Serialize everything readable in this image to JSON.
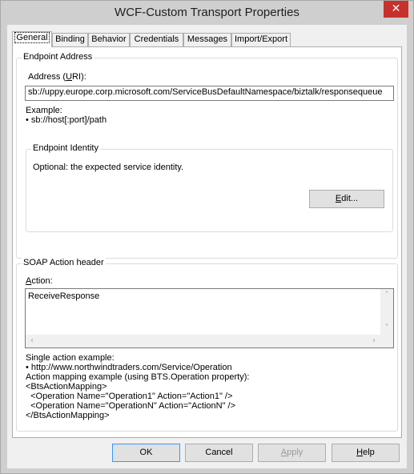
{
  "window": {
    "title": "WCF-Custom Transport Properties",
    "close_glyph": "✕"
  },
  "tabs": [
    {
      "label": "General",
      "active": true
    },
    {
      "label": "Binding"
    },
    {
      "label": "Behavior"
    },
    {
      "label": "Credentials"
    },
    {
      "label": "Messages"
    },
    {
      "label": "Import/Export"
    }
  ],
  "endpoint_address": {
    "group_label": "Endpoint Address",
    "address_label_pre": "Address (",
    "address_label_u": "U",
    "address_label_post": "RI):",
    "address_value": "sb://uppy.europe.corp.microsoft.com/ServiceBusDefaultNamespace/biztalk/responsequeue",
    "example_title": "Example:",
    "example_line": "• sb://host[:port]/path"
  },
  "endpoint_identity": {
    "group_label": "Endpoint Identity",
    "description": "Optional: the expected service identity.",
    "edit_button_u": "E",
    "edit_button_rest": "dit..."
  },
  "soap_action": {
    "group_label": "SOAP Action header",
    "action_label_u": "A",
    "action_label_rest": "ction:",
    "action_value": "ReceiveResponse",
    "examples": [
      "Single action example:",
      "• http://www.northwindtraders.com/Service/Operation",
      "Action mapping example (using BTS.Operation property):",
      "<BtsActionMapping>",
      "  <Operation Name=\"Operation1\" Action=\"Action1\" />",
      "  <Operation Name=\"OperationN\" Action=\"ActionN\" />",
      "</BtsActionMapping>"
    ]
  },
  "buttons": {
    "ok": "OK",
    "cancel": "Cancel",
    "apply_u": "A",
    "apply_rest": "pply",
    "help_u": "H",
    "help_rest": "elp"
  },
  "icons": {
    "scroll_left": "‹",
    "scroll_right": "›",
    "scroll_up": "˄",
    "scroll_down": "˅"
  }
}
